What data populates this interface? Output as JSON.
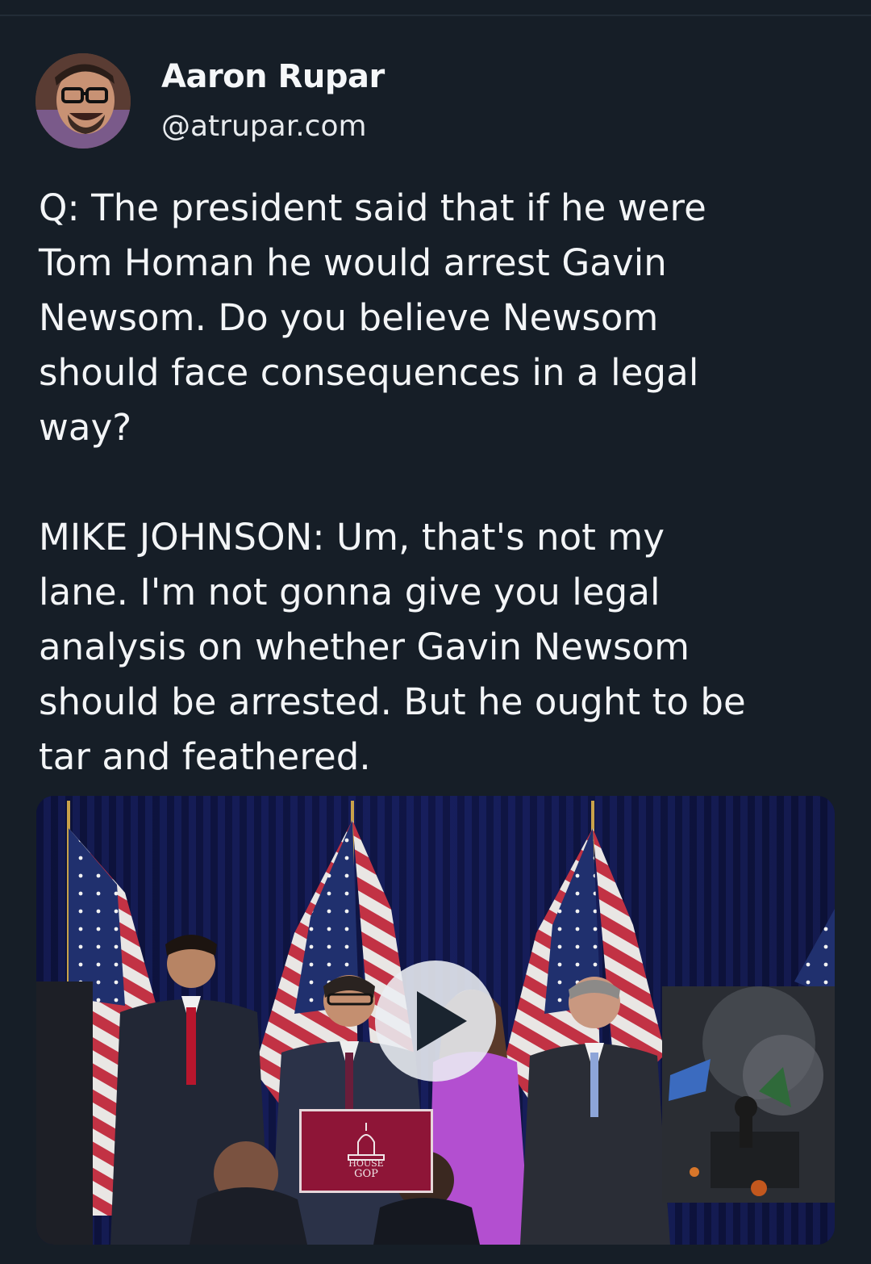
{
  "post": {
    "author_name": "Aaron Rupar",
    "author_handle": "@atrupar.com",
    "text": "Q: The president said that if he were\nTom Homan he would arrest Gavin\nNewsom. Do you believe Newsom\nshould face consequences in a legal\nway?\n\nMIKE JOHNSON: Um, that's not my\nlane. I'm not gonna give you legal\nanalysis on whether Gavin Newsom\nshould be arrested. But he ought to be\ntar and feathered."
  },
  "video": {
    "play_icon": "play-icon",
    "podium_sign": {
      "line1": "HOUSE",
      "line2": "GOP"
    }
  },
  "colors": {
    "background": "#161e27",
    "text": "#f3f5f7",
    "podium": "#8e1537"
  }
}
